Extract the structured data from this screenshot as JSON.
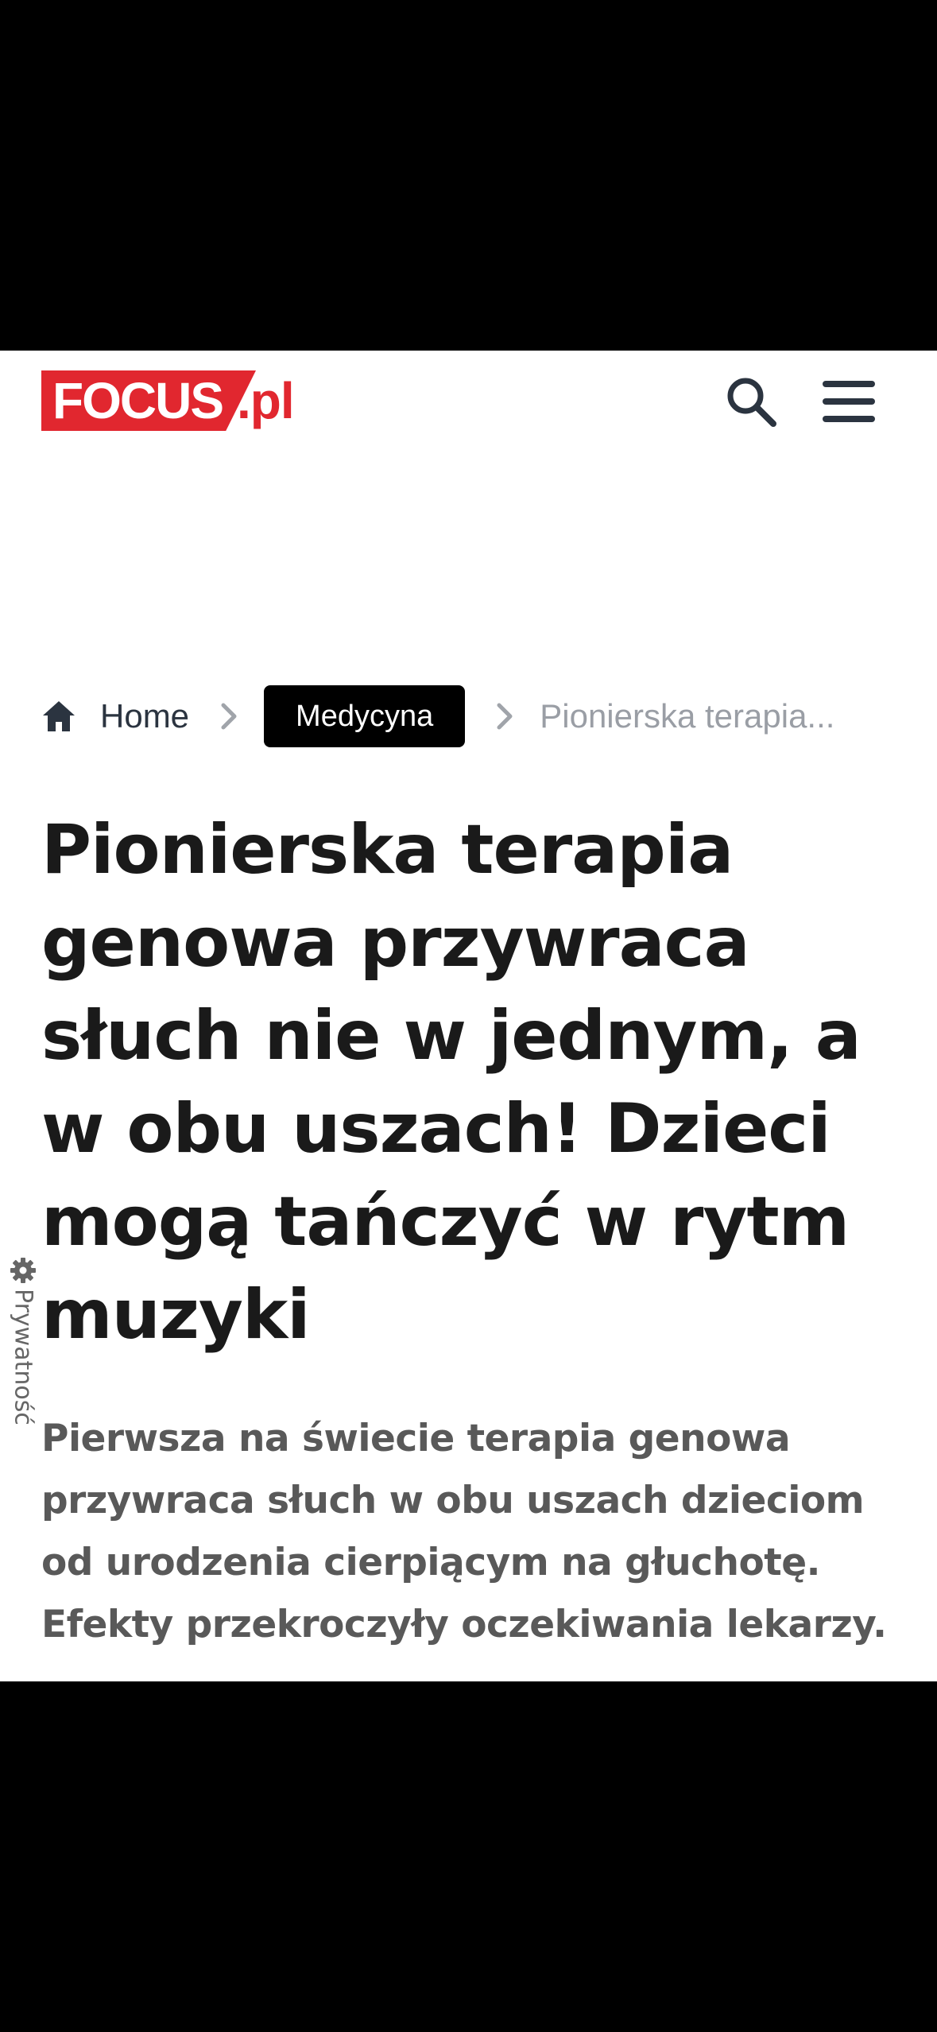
{
  "header": {
    "logo_focus": "FOCUS",
    "logo_pl": ".pl",
    "brand_color": "#e1272f",
    "search_icon": "search-icon",
    "menu_icon": "hamburger-menu-icon"
  },
  "breadcrumb": {
    "home_label": "Home",
    "category_label": "Medycyna",
    "current_label": "Pionierska terapia..."
  },
  "article": {
    "title": "Pionierska terapia genowa przywraca słuch nie w jednym, a w obu uszach! Dzieci mogą tańczyć w rytm muzyki",
    "lead": "Pierwsza na świecie terapia genowa przywraca słuch w obu uszach dzieciom od urodzenia cierpiącym na głuchotę. Efekty przekroczyły oczekiwania lekarzy."
  },
  "privacy": {
    "label": "Prywatność",
    "icon": "gear-icon"
  }
}
